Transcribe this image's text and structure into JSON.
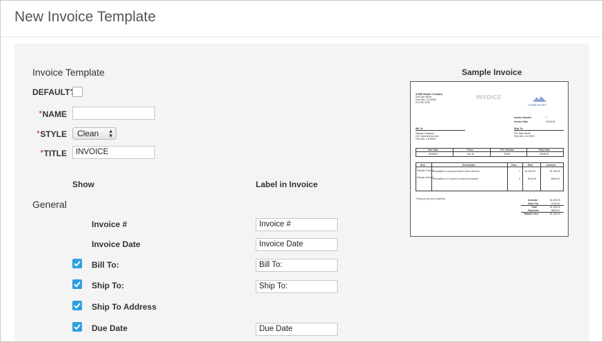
{
  "page": {
    "title": "New Invoice Template"
  },
  "form": {
    "section_title": "Invoice Template",
    "default_label": "DEFAULT?",
    "name_label": "NAME",
    "name_value": "",
    "style_label": "STYLE",
    "style_value": "Clean",
    "title_label": "TITLE",
    "title_value": "INVOICE",
    "required_mark": "*"
  },
  "columns": {
    "show": "Show",
    "label_in_invoice": "Label in Invoice"
  },
  "general": {
    "heading": "General",
    "fields": [
      {
        "name": "Invoice #",
        "checked": false,
        "label": "Invoice #"
      },
      {
        "name": "Invoice Date",
        "checked": false,
        "label": "Invoice Date"
      },
      {
        "name": "Bill To:",
        "checked": true,
        "label": "Bill To:"
      },
      {
        "name": "Ship To:",
        "checked": true,
        "label": "Ship To:"
      },
      {
        "name": "Ship To Address",
        "checked": true,
        "label": null
      },
      {
        "name": "Due Date",
        "checked": true,
        "label": "Due Date"
      }
    ]
  },
  "sample": {
    "heading": "Sample Invoice",
    "company": [
      "ACME Sample Company",
      "0000 4th Street",
      "Palo Alto, CA 94000",
      "510-000-8760"
    ],
    "invoice_title": "INVOICE",
    "logo_text": "ACME Books",
    "meta": [
      {
        "k": "Invoice Number",
        "v": "7"
      },
      {
        "k": "Invoice Date",
        "v": "04/22/15"
      }
    ],
    "bill_to_label": "Bill To:",
    "bill_to": [
      "Sample Customer",
      "100 Cathedral Avenue",
      "Palo Alto, CA 94301"
    ],
    "ship_to_label": "Ship To:",
    "ship_to": [
      "331 Main Street",
      "Palo Alto, CA 94301"
    ],
    "terms_headers": [
      "Due Date",
      "Terms",
      "P.O. Number",
      "Ship Date"
    ],
    "terms_values": [
      "05/08/15",
      "Net 30",
      "00001",
      "05/08/15"
    ],
    "item_headers": [
      "Item",
      "Description",
      "Hour",
      "Rate",
      "Amount"
    ],
    "items": [
      {
        "item": "Sample Product",
        "desc": "Description of a product sold to this customer",
        "hour": "1",
        "rate": "$1,000.00",
        "amount": "$1,000.00"
      },
      {
        "item": "Sample Service",
        "desc": "Description of X hours of a service provided",
        "hour": "5",
        "rate": "$100.00",
        "amount": "$500.00"
      }
    ],
    "thanks": "Thank you for your business.",
    "totals": [
      {
        "k": "Subtotal",
        "v": "$1,500.00"
      },
      {
        "k": "Sales Tax",
        "v": "$135.00"
      },
      {
        "k": "Total",
        "v": "$1,635.00"
      },
      {
        "k": "Payments",
        "v": "$655.00"
      },
      {
        "k": "Balance Due",
        "v": "$1,000.00"
      }
    ]
  },
  "colors": {
    "accent": "#2d9fe0",
    "required": "#c0392b",
    "panel_bg": "#f4f4f4"
  }
}
